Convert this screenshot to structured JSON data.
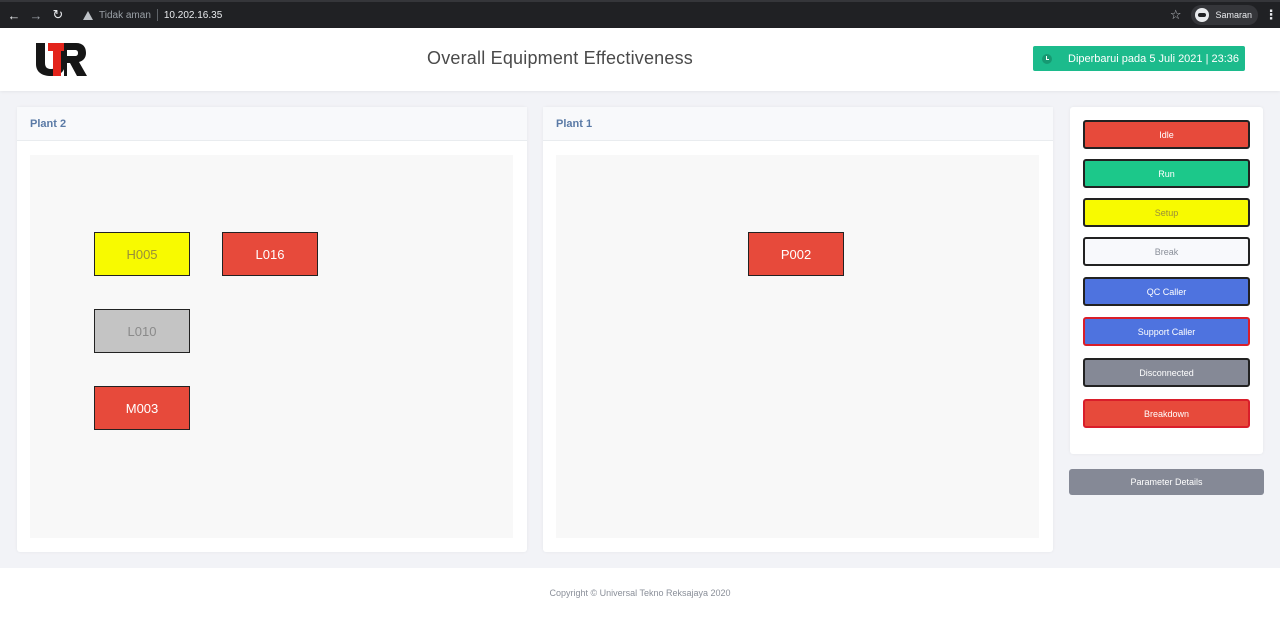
{
  "browser": {
    "security_label": "Tidak aman",
    "url": "10.202.16.35",
    "profile_label": "Samaran"
  },
  "header": {
    "title": "Overall Equipment Effectiveness",
    "updated_label": "Diperbarui pada 5 Juli 2021 | 23:36"
  },
  "plants": [
    {
      "name": "Plant 2",
      "machines": [
        {
          "id": "H005",
          "status": "Setup"
        },
        {
          "id": "L016",
          "status": "Idle"
        },
        {
          "id": "L010",
          "status": "Disconnected"
        },
        {
          "id": "M003",
          "status": "Idle"
        }
      ]
    },
    {
      "name": "Plant 1",
      "machines": [
        {
          "id": "P002",
          "status": "Idle"
        }
      ]
    }
  ],
  "legend": [
    {
      "label": "Idle",
      "color": "#e74a3b",
      "text_color": "#ffffff",
      "border": "#222222"
    },
    {
      "label": "Run",
      "color": "#1cc88a",
      "text_color": "#ffffff",
      "border": "#222222"
    },
    {
      "label": "Setup",
      "color": "#f8fa00",
      "text_color": "#9a8f3a",
      "border": "#222222"
    },
    {
      "label": "Break",
      "color": "#f8f9fc",
      "text_color": "#8a8f99",
      "border": "#222222"
    },
    {
      "label": "QC Caller",
      "color": "#4e73df",
      "text_color": "#ffffff",
      "border": "#222222"
    },
    {
      "label": "Support Caller",
      "color": "#4e73df",
      "text_color": "#ffffff",
      "border": "#d91e2a"
    },
    {
      "label": "Disconnected",
      "color": "#858996",
      "text_color": "#ffffff",
      "border": "#222222"
    },
    {
      "label": "Breakdown",
      "color": "#e74a3b",
      "text_color": "#ffffff",
      "border": "#d91e2a"
    }
  ],
  "parameter_button": "Parameter Details",
  "footer": {
    "copyright": "Copyright © Universal Tekno Reksajaya 2020"
  },
  "machine_colors": {
    "Setup": {
      "bg": "#f8fa00",
      "fg": "#9a8f3a"
    },
    "Idle": {
      "bg": "#e74a3b",
      "fg": "#ffffff"
    },
    "Disconnected": {
      "bg": "#c4c4c4",
      "fg": "#8a8a8a"
    }
  }
}
